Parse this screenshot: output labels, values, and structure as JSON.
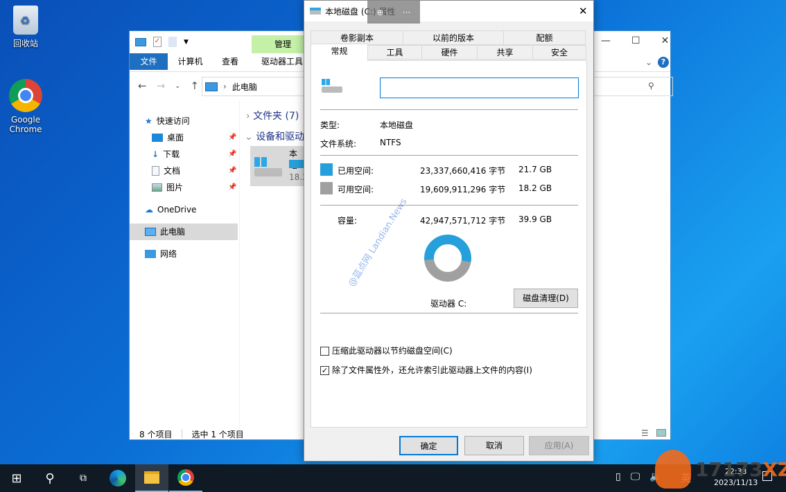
{
  "desktop": {
    "icons": [
      {
        "label": "回收站"
      },
      {
        "label": "Google Chrome"
      }
    ]
  },
  "explorer": {
    "quick_access": [
      "computer-icon",
      "properties-icon",
      "new-folder-icon"
    ],
    "manage_label": "管理",
    "ribbon_tabs": [
      "文件",
      "计算机",
      "查看",
      "驱动器工具"
    ],
    "address": "此电脑",
    "nav": {
      "quick": "快速访问",
      "items": [
        {
          "label": "桌面"
        },
        {
          "label": "下载"
        },
        {
          "label": "文档"
        },
        {
          "label": "图片"
        }
      ],
      "onedrive": "OneDrive",
      "thispc": "此电脑",
      "network": "网络"
    },
    "groups": {
      "folders": "文件夹 (7)",
      "devices": "设备和驱动"
    },
    "drive": {
      "name": "本地",
      "free": "18.2",
      "used_fraction": 0.543
    },
    "status": {
      "count": "8 个项目",
      "selected": "选中 1 个项目"
    }
  },
  "dialog": {
    "title": "本地磁盘 (C:) 属性",
    "tabs_row1": [
      "卷影副本",
      "以前的版本",
      "配额"
    ],
    "tabs_row2": [
      "常规",
      "工具",
      "硬件",
      "共享",
      "安全"
    ],
    "active_tab": "常规",
    "name_value": "",
    "type_label": "类型:",
    "type_value": "本地磁盘",
    "fs_label": "文件系统:",
    "fs_value": "NTFS",
    "used": {
      "label": "已用空间:",
      "bytes": "23,337,660,416 字节",
      "size": "21.7 GB",
      "color": "#26a0da"
    },
    "free": {
      "label": "可用空间:",
      "bytes": "19,609,911,296 字节",
      "size": "18.2 GB",
      "color": "#a0a0a0"
    },
    "capacity": {
      "label": "容量:",
      "bytes": "42,947,571,712 字节",
      "size": "39.9 GB"
    },
    "drive_label": "驱动器 C:",
    "cleanup_button": "磁盘清理(D)",
    "compress": {
      "label": "压缩此驱动器以节约磁盘空间(C)",
      "checked": false
    },
    "index": {
      "label": "除了文件属性外，还允许索引此驱动器上文件的内容(I)",
      "checked": true
    },
    "buttons": {
      "ok": "确定",
      "cancel": "取消",
      "apply": "应用(A)"
    }
  },
  "watermark": "@蓝点网 Landian.News",
  "taskbar": {
    "ime": "英",
    "time": "22:33",
    "date": "2023/11/13"
  },
  "logo_watermark": "17173XZ"
}
